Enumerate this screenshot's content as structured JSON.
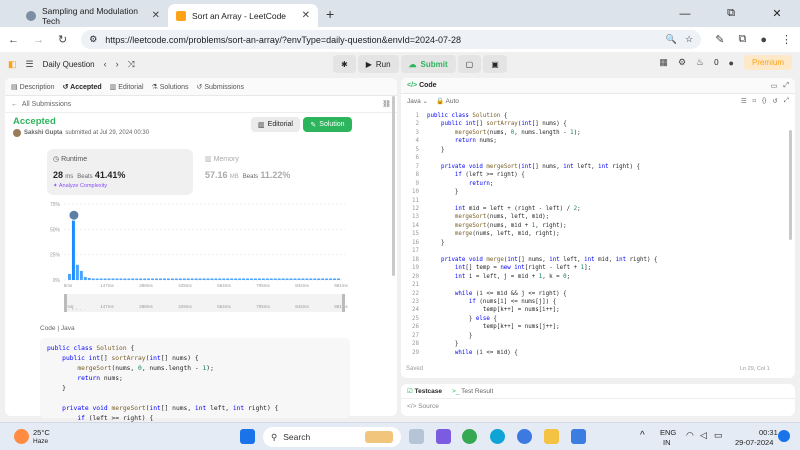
{
  "browser": {
    "tabs": [
      {
        "title": "Sampling and Modulation Tech",
        "active": false
      },
      {
        "title": "Sort an Array - LeetCode",
        "active": true
      }
    ],
    "new_tab": "+",
    "url": "https://leetcode.com/problems/sort-an-array/?envType=daily-question&envId=2024-07-28",
    "controls": {
      "minimize": "—",
      "restore": "⧉",
      "close": "✕"
    }
  },
  "leetcode": {
    "daily_question": "Daily Question",
    "run": "Run",
    "submit": "Submit",
    "premium": "Premium",
    "fire_count": "0"
  },
  "left_panel": {
    "tabs": [
      "Description",
      "Accepted",
      "Editorial",
      "Solutions",
      "Submissions"
    ],
    "all_submissions": "All Submissions",
    "status": "Accepted",
    "author": "Sakshi Gupta",
    "submitted": "submitted at Jul 29, 2024 00:30",
    "editorial_btn": "Editorial",
    "solution_btn": "Solution",
    "runtime": {
      "label": "Runtime",
      "value": "28",
      "unit": "ms",
      "beats_label": "Beats",
      "beats": "41.41%",
      "analyze": "Analyze Complexity"
    },
    "memory": {
      "label": "Memory",
      "value": "57.16",
      "unit": "MB",
      "beats_label": "Beats",
      "beats": "11.22%"
    },
    "code_header": "Code",
    "code_lang": "Java",
    "code_lines": [
      "public class Solution {",
      "    public int[] sortArray(int[] nums) {",
      "        mergeSort(nums, 0, nums.length - 1);",
      "        return nums;",
      "    }",
      "",
      "    private void mergeSort(int[] nums, int left, int right) {",
      "        if (left >= right) {"
    ]
  },
  "chart_data": {
    "type": "bar",
    "yticks": [
      "75%",
      "50%",
      "25%",
      "0%"
    ],
    "xticks": [
      "5ms",
      "147ms",
      "288ms",
      "429ms",
      "564ms",
      "705ms",
      "842ms",
      "981ms"
    ],
    "ylim": [
      0,
      75
    ],
    "values": [
      6,
      60,
      15,
      9,
      3,
      2,
      1.5,
      1.5,
      1.5,
      1.5,
      1.5,
      1.5,
      1.5,
      1.5,
      1.5,
      1.5,
      1.5,
      1.5,
      1.5,
      1.5,
      1.5,
      1.5,
      1.5,
      1.5,
      1.5,
      1.5,
      1.5,
      1.5,
      1.5,
      1.5,
      1.5,
      1.5,
      1.5,
      1.5,
      1.5,
      1.5,
      1.5,
      1.5,
      1.5,
      1.5,
      1.5,
      1.5,
      1.5,
      1.5,
      1.5,
      1.5,
      1.5,
      1.5,
      1.5,
      1.5,
      1.5,
      1.5,
      1.5,
      1.5,
      1.5,
      1.5,
      1.5,
      1.5,
      1.5,
      1.5,
      1.5,
      1.5,
      1.5,
      1.5,
      1.5,
      1.5,
      1.5,
      1.5,
      1.5
    ],
    "highlight_index": 1
  },
  "right_panel": {
    "title": "Code",
    "lang": "Java",
    "auto": "Auto",
    "lines": [
      "public class Solution {",
      "    public int[] sortArray(int[] nums) {",
      "        mergeSort(nums, 0, nums.length - 1);",
      "        return nums;",
      "    }",
      "",
      "    private void mergeSort(int[] nums, int left, int right) {",
      "        if (left >= right) {",
      "            return;",
      "        }",
      "",
      "        int mid = left + (right - left) / 2;",
      "        mergeSort(nums, left, mid);",
      "        mergeSort(nums, mid + 1, right);",
      "        merge(nums, left, mid, right);",
      "    }",
      "",
      "    private void merge(int[] nums, int left, int mid, int right) {",
      "        int[] temp = new int[right - left + 1];",
      "        int i = left, j = mid + 1, k = 0;",
      "",
      "        while (i <= mid && j <= right) {",
      "            if (nums[i] <= nums[j]) {",
      "                temp[k++] = nums[i++];",
      "            } else {",
      "                temp[k++] = nums[j++];",
      "            }",
      "        }",
      "        while (i <= mid) {"
    ],
    "saved": "Saved",
    "cursor": "Ln 29, Col 1",
    "testcase": "Testcase",
    "test_result": "Test Result",
    "source": "Source"
  },
  "taskbar": {
    "temp": "25°C",
    "weather": "Haze",
    "search": "Search",
    "lang1": "ENG",
    "lang2": "IN",
    "time": "00:31",
    "date": "29-07-2024"
  }
}
